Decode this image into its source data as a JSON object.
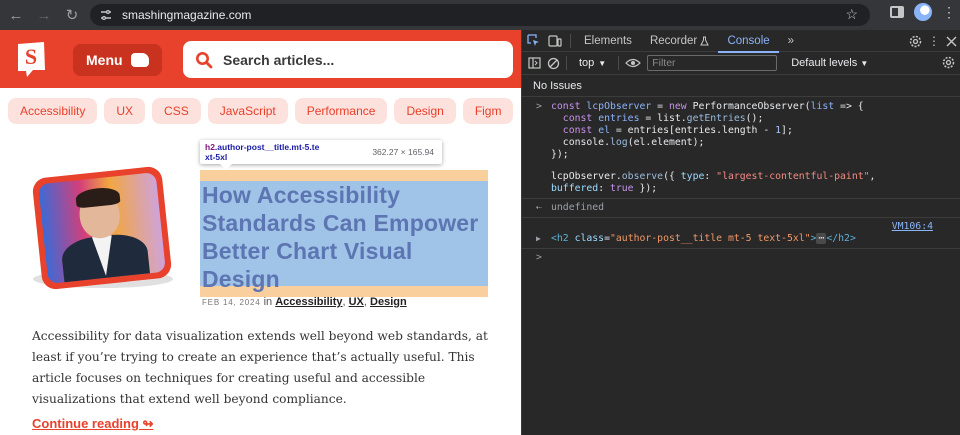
{
  "browser": {
    "url": "smashingmagazine.com",
    "back_glyph": "←",
    "forward_glyph": "→",
    "reload_glyph": "↻",
    "star_glyph": "☆",
    "menu_glyph": "⋮"
  },
  "site": {
    "menu_label": "Menu",
    "search_placeholder": "Search articles...",
    "tags": [
      "Accessibility",
      "UX",
      "CSS",
      "JavaScript",
      "Performance",
      "Design",
      "Figm"
    ],
    "inspect_tooltip": {
      "tag": "h2",
      "class_line1": ".author-post__title.mt-5.te",
      "class_line2": "xt-5xl",
      "size": "362.27 × 165.94"
    },
    "article": {
      "title": "How Accessibility Standards Can Empower Better Chart Visual Design",
      "date": "FEB 14, 2024",
      "in_word": " in ",
      "categories": [
        "Accessibility",
        "UX",
        "Design"
      ],
      "excerpt": "Accessibility for data visualization extends well beyond web standards, at least if you’re trying to create an experience that’s actually useful. This article focuses on techniques for creating useful and accessible visualizations that extend well beyond compliance.",
      "read_more": "Continue reading ↬"
    }
  },
  "devtools": {
    "tabs": [
      "Elements",
      "Recorder",
      "Console"
    ],
    "active_tab": "Console",
    "more_tabs_glyph": "»",
    "context": "top",
    "filter_placeholder": "Filter",
    "levels": "Default levels",
    "issues": "No Issues",
    "code": {
      "l1_a": "const ",
      "l1_b": "lcpObserver",
      "l1_c": " = ",
      "l1_d": "new ",
      "l1_e": "PerformanceObserver",
      "l1_f": "(",
      "l1_g": "list",
      "l1_h": " => {",
      "l2_a": "  const ",
      "l2_b": "entries",
      "l2_c": " = list.",
      "l2_d": "getEntries",
      "l2_e": "();",
      "l3_a": "  const ",
      "l3_b": "el",
      "l3_c": " = entries[entries.length - ",
      "l3_d": "1",
      "l3_e": "];",
      "l4_a": "  console.",
      "l4_b": "log",
      "l4_c": "(el.element);",
      "l5": "});",
      "l6_a": "lcpObserver.",
      "l6_b": "observe",
      "l6_c": "({ ",
      "l6_d": "type",
      "l6_e": ": ",
      "l6_f": "\"largest-contentful-paint\"",
      "l6_g": ",",
      "l7_a": "buffered",
      "l7_b": ": ",
      "l7_c": "true",
      "l7_d": " });",
      "result": "undefined",
      "source_link": "VM106:4",
      "el_tag_open": "<h2 ",
      "el_attr": "class",
      "el_eq": "=",
      "el_val": "\"author-post__title mt-5 text-5xl\"",
      "el_gt": ">",
      "el_ellipsis": "⋯",
      "el_close": "</h2>",
      "prompt": ">",
      "result_prompt": "⇠",
      "expand": "▶",
      "input_prompt": ">"
    }
  }
}
